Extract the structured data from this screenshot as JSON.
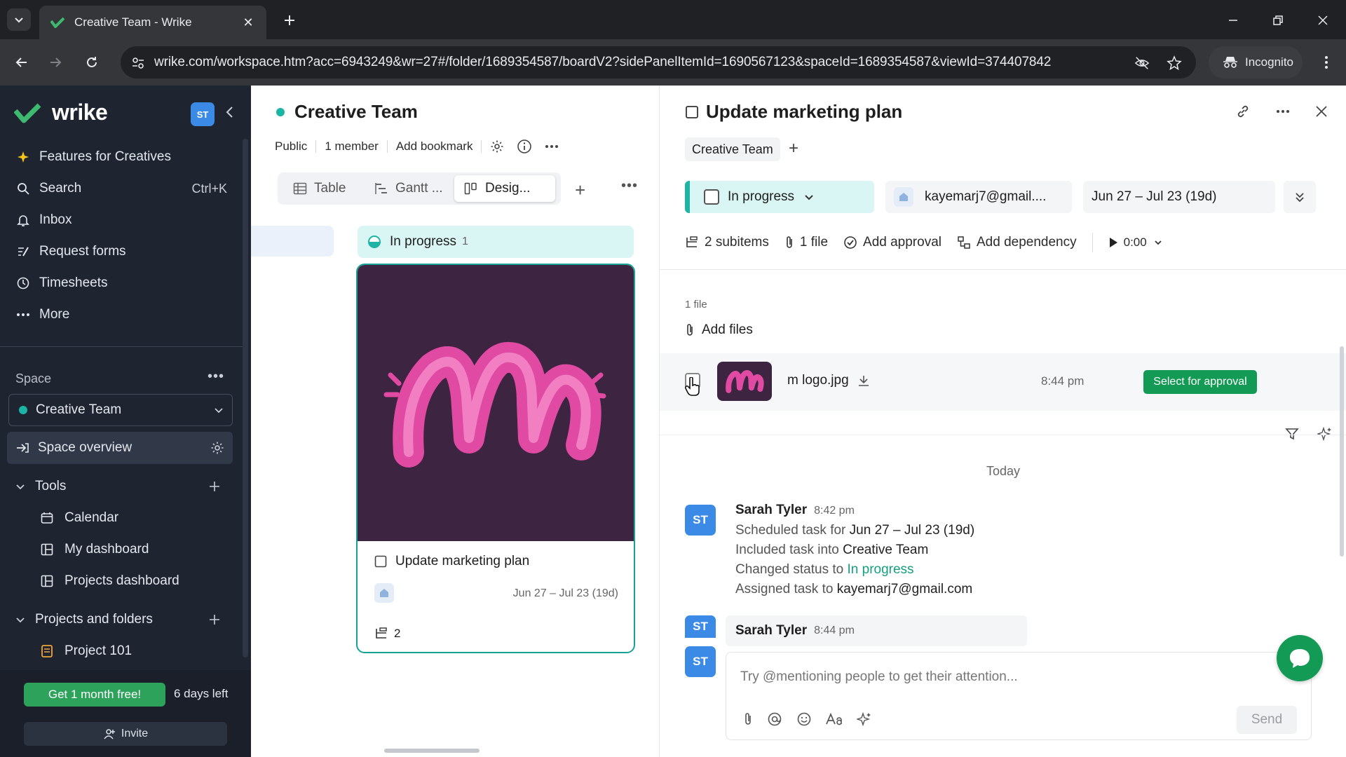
{
  "browser": {
    "tab_title": "Creative Team - Wrike",
    "url": "wrike.com/workspace.htm?acc=6943249&wr=27#/folder/1689354587/boardV2?sidePanelItemId=1690567123&spaceId=1689354587&viewId=374407842",
    "incognito_label": "Incognito"
  },
  "sidebar": {
    "logo_text": "wrike",
    "avatar": "ST",
    "nav": [
      {
        "label": "Features for Creatives",
        "icon": "sparkle-icon"
      },
      {
        "label": "Search",
        "icon": "search-icon",
        "shortcut": "Ctrl+K"
      },
      {
        "label": "Inbox",
        "icon": "bell-icon"
      },
      {
        "label": "Request forms",
        "icon": "form-icon"
      },
      {
        "label": "Timesheets",
        "icon": "clock-icon"
      },
      {
        "label": "More",
        "icon": "dots-icon"
      }
    ],
    "space_label": "Space",
    "space_name": "Creative Team",
    "space_overview": "Space overview",
    "tools_label": "Tools",
    "tools": [
      {
        "label": "Calendar",
        "icon": "calendar-icon"
      },
      {
        "label": "My dashboard",
        "icon": "dashboard-icon"
      },
      {
        "label": "Projects dashboard",
        "icon": "dashboard-icon"
      }
    ],
    "projects_label": "Projects and folders",
    "projects": [
      {
        "label": "Project 101",
        "icon": "project-icon"
      }
    ],
    "promo_label": "Get 1 month free!",
    "days_left": "6 days left",
    "invite_label": "Invite"
  },
  "board": {
    "title": "Creative Team",
    "meta": {
      "visibility": "Public",
      "members": "1 member",
      "bookmark": "Add bookmark"
    },
    "views": [
      {
        "label": "Table",
        "active": false
      },
      {
        "label": "Gantt ...",
        "active": false
      },
      {
        "label": "Desig...",
        "active": true
      }
    ],
    "column": {
      "label": "In progress",
      "count": "1"
    },
    "card": {
      "title": "Update marketing plan",
      "date": "Jun 27 – Jul 23 (19d)",
      "subitems": "2"
    }
  },
  "panel": {
    "title": "Update marketing plan",
    "location": "Creative Team",
    "status": "In progress",
    "assignee": "kayemarj7@gmail....",
    "dates": "Jun 27 – Jul 23 (19d)",
    "toolbar": {
      "subitems": "2 subitems",
      "files": "1 file",
      "approval": "Add approval",
      "dependency": "Add dependency",
      "timer": "0:00"
    },
    "files_count": "1 file",
    "add_files": "Add files",
    "file": {
      "name": "m logo.jpg",
      "time": "8:44 pm",
      "action": "Select for approval"
    },
    "feed_date": "Today",
    "activities": [
      {
        "author": "Sarah Tyler",
        "time": "8:42 pm",
        "lines": [
          {
            "prefix": "Scheduled task for ",
            "value": "Jun 27 – Jul 23 (19d)"
          },
          {
            "prefix": "Included task into ",
            "value": "Creative Team"
          },
          {
            "prefix": "Changed status to ",
            "value": "In progress"
          },
          {
            "prefix": "Assigned task to ",
            "value": "kayemarj7@gmail.com"
          }
        ]
      },
      {
        "author": "Sarah Tyler",
        "time": "8:44 pm"
      }
    ],
    "comment_placeholder": "Try @mentioning people to get their attention...",
    "send_label": "Send",
    "avatar": "ST"
  },
  "colors": {
    "sidebar_bg": "#1e2430",
    "accent_green": "#139a54",
    "status_teal": "#d9f6f4",
    "avatar_blue": "#3a8ae6"
  }
}
